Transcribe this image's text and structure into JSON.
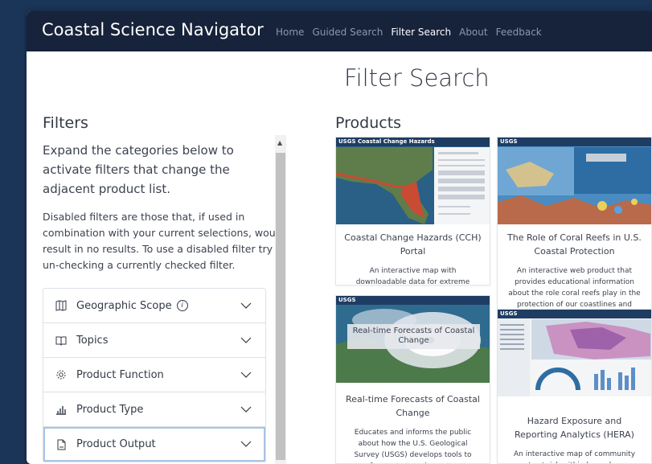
{
  "app": {
    "title": "Coastal Science Navigator",
    "nav": [
      "Home",
      "Guided Search",
      "Filter Search",
      "About",
      "Feedback"
    ],
    "active_nav": "Filter Search"
  },
  "page": {
    "title": "Filter Search"
  },
  "filters": {
    "heading": "Filters",
    "intro": "Expand the categories below to activate filters that change the adjacent product list.",
    "disabled_note": "Disabled filters are those that, if used in combination with your current selections, would result in no results. To use a disabled filter try un-checking a currently checked filter.",
    "categories": [
      {
        "label": "Geographic Scope",
        "icon": "map-icon",
        "info": true
      },
      {
        "label": "Topics",
        "icon": "book-icon",
        "info": false
      },
      {
        "label": "Product Function",
        "icon": "gear-icon",
        "info": false
      },
      {
        "label": "Product Type",
        "icon": "bar-chart-icon",
        "info": false
      },
      {
        "label": "Product Output",
        "icon": "document-icon",
        "info": false
      }
    ]
  },
  "products": {
    "heading": "Products",
    "items": [
      {
        "title": "Coastal Change Hazards (CCH) Portal",
        "description": "An interactive map with downloadable data for extreme storms, shoreline changes, and sea level rise.",
        "thumb_banner": "USGS Coastal Change Hazards"
      },
      {
        "title": "The Role of Coral Reefs in U.S. Coastal Protection",
        "description": "An interactive web product that provides educational information about the role coral reefs play in the protection of our coastlines and beyond.",
        "thumb_banner": "USGS"
      },
      {
        "title": "Real-time Forecasts of Coastal Change",
        "description": "Educates and informs the public about how the U.S. Geological Survey (USGS) develops tools to forecast storm impacts.",
        "thumb_banner": "USGS",
        "thumb_overlay": "Real-time Forecasts of Coastal Change"
      },
      {
        "title": "Hazard Exposure and Reporting Analytics (HERA)",
        "description": "An interactive map of community assets at risk within hazard zones.",
        "thumb_banner": "USGS"
      }
    ]
  },
  "colors": {
    "navbar": "#17223b",
    "page_background": "#1a3558",
    "text": "#333a45",
    "nav_inactive": "#8c97ab"
  }
}
